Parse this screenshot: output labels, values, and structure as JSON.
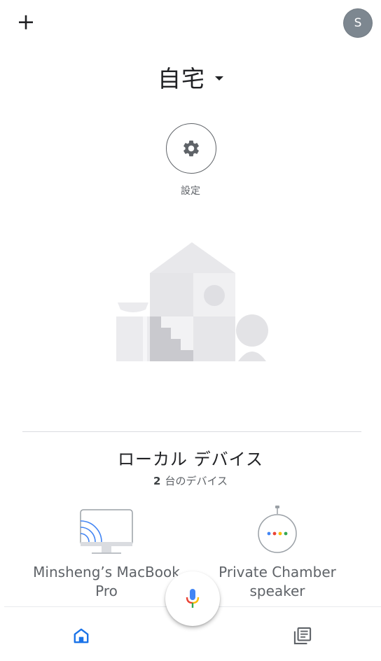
{
  "header": {
    "add_icon": "plus-icon",
    "avatar_initial": "S",
    "home_name": "自宅",
    "home_dropdown_icon": "caret-down-icon"
  },
  "settings": {
    "icon": "gear-icon",
    "label": "設定"
  },
  "local_devices": {
    "title": "ローカル デバイス",
    "count": "2",
    "count_suffix": "台のデバイス",
    "devices": [
      {
        "name_line1": "Minsheng’s MacBook",
        "name_line2": "Pro",
        "icon": "laptop-cast-icon"
      },
      {
        "name_line1": "Private Chamber",
        "name_line2": "speaker",
        "icon": "google-home-mini-icon"
      }
    ]
  },
  "bottom_nav": {
    "home_tab_icon": "home-icon",
    "feed_tab_icon": "feed-icon",
    "mic_icon": "mic-icon"
  },
  "colors": {
    "accent": "#1a73e8",
    "avatar_bg": "#7d8790",
    "google_blue": "#4285f4",
    "google_red": "#ea4335",
    "google_yellow": "#fbbc05",
    "google_green": "#34a853"
  }
}
